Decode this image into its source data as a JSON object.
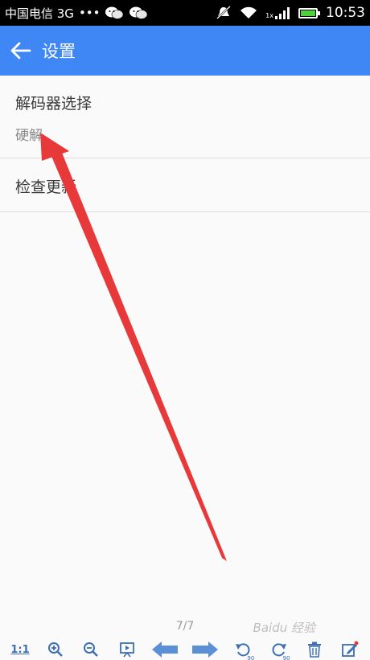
{
  "status_bar": {
    "carrier": "中国电信 3G",
    "dots": "•••",
    "time": "10:53",
    "signal_label": "1x"
  },
  "app_bar": {
    "title": "设置",
    "accent_color": "#3f87f5"
  },
  "settings": [
    {
      "title": "解码器选择",
      "subtitle": "硬解"
    },
    {
      "title": "检查更新"
    }
  ],
  "viewer": {
    "page_indicator": "7/7",
    "ratio_label": "1:1",
    "rotate_left_label": "90",
    "rotate_right_label": "90",
    "watermark": "Baidu 经验"
  },
  "annotation": {
    "color": "#e8393a"
  }
}
